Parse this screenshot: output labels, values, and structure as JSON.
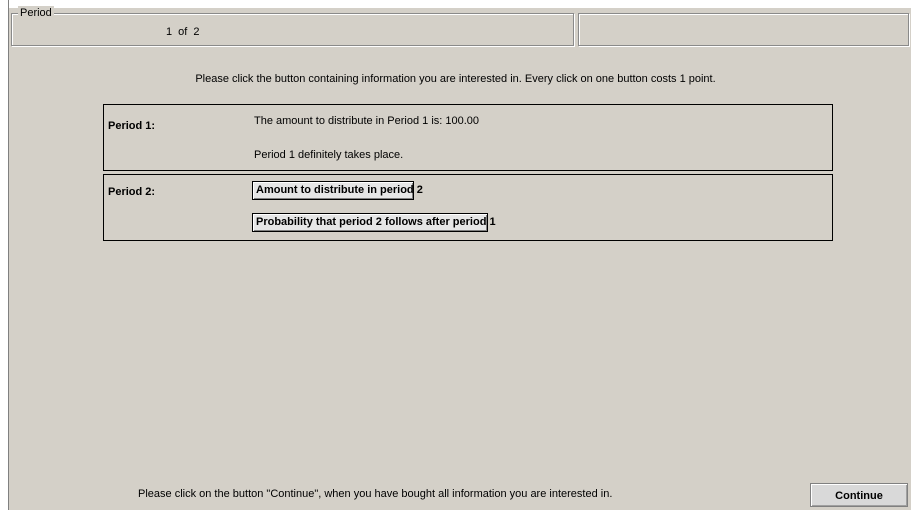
{
  "header": {
    "period_legend": "Period",
    "period_counter": "1   of   2"
  },
  "instruction": "Please click the button containing information you are interested in. Every click on one button costs 1 point.",
  "periods": [
    {
      "label": "Period 1:",
      "lines": [
        "The amount to distribute in Period 1 is: 100.00",
        "Period 1 definitely takes place."
      ]
    },
    {
      "label": "Period 2:",
      "buttons": [
        "Amount to distribute in period 2",
        "Probability that period 2 follows after period 1"
      ]
    }
  ],
  "footer": {
    "hint": "Please click on the button \"Continue\", when you have bought all information you are interested in.",
    "continue_label": "Continue"
  }
}
